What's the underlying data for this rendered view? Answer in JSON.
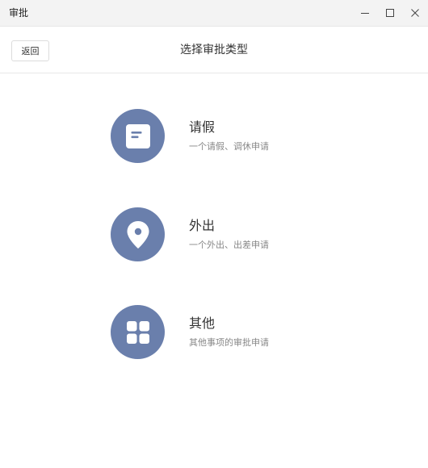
{
  "window": {
    "title": "审批"
  },
  "header": {
    "back_label": "返回",
    "title": "选择审批类型"
  },
  "options": [
    {
      "title": "请假",
      "description": "一个请假、调休申请",
      "icon": "document-icon"
    },
    {
      "title": "外出",
      "description": "一个外出、出差申请",
      "icon": "location-pin-icon"
    },
    {
      "title": "其他",
      "description": "其他事项的审批申请",
      "icon": "grid-icon"
    }
  ],
  "colors": {
    "icon_circle": "#6a7fac",
    "titlebar_bg": "#f3f3f3"
  }
}
